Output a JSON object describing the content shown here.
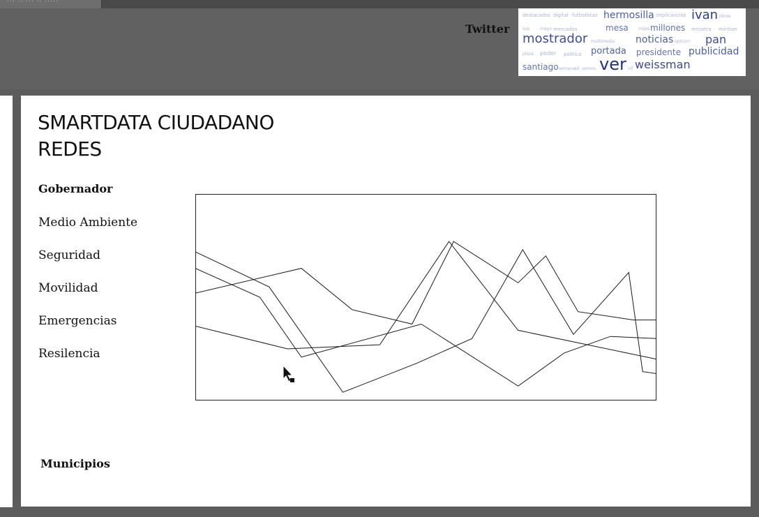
{
  "window": {
    "tab_text": "··· ·· ··· ·· ·····"
  },
  "header": {
    "twitter_label": "Twitter",
    "word_cloud": [
      {
        "text": "destacados",
        "size": 7,
        "color": "#aab3d6"
      },
      {
        "text": "digital",
        "size": 7,
        "color": "#aab3d6"
      },
      {
        "text": "futbolistas",
        "size": 7,
        "color": "#aab3d6"
      },
      {
        "text": "hermosilla",
        "size": 14,
        "color": "#4b5ea8"
      },
      {
        "text": "implicancias",
        "size": 7,
        "color": "#aab3d6"
      },
      {
        "text": "ivan",
        "size": 18,
        "color": "#2f3f8f"
      },
      {
        "text": "libros",
        "size": 6,
        "color": "#aab3d6"
      },
      {
        "text": "luis",
        "size": 6,
        "color": "#aab3d6"
      },
      {
        "text": "mayo",
        "size": 6,
        "color": "#aab3d6"
      },
      {
        "text": "mercados",
        "size": 7,
        "color": "#aab3d6"
      },
      {
        "text": "mesa",
        "size": 12,
        "color": "#6272b5"
      },
      {
        "text": "mijas",
        "size": 6,
        "color": "#aab3d6"
      },
      {
        "text": "millones",
        "size": 12,
        "color": "#6272b5"
      },
      {
        "text": "ministra",
        "size": 7,
        "color": "#aab3d6"
      },
      {
        "text": "mintion",
        "size": 7,
        "color": "#aab3d6"
      },
      {
        "text": "mostrador",
        "size": 18,
        "color": "#3b4c99"
      },
      {
        "text": "multimedia",
        "size": 6,
        "color": "#aab3d6"
      },
      {
        "text": "noticias",
        "size": 14,
        "color": "#4b5ea8"
      },
      {
        "text": "opinion",
        "size": 6,
        "color": "#aab3d6"
      },
      {
        "text": "pan",
        "size": 16,
        "color": "#3b4c99"
      },
      {
        "text": "plaza",
        "size": 6,
        "color": "#aab3d6"
      },
      {
        "text": "poder",
        "size": 8,
        "color": "#aab3d6"
      },
      {
        "text": "politica",
        "size": 7,
        "color": "#aab3d6"
      },
      {
        "text": "portada",
        "size": 13,
        "color": "#5062ad"
      },
      {
        "text": "presidente",
        "size": 12,
        "color": "#6272b5"
      },
      {
        "text": "publicidad",
        "size": 14,
        "color": "#4b5ea8"
      },
      {
        "text": "santiago",
        "size": 12,
        "color": "#6272b5"
      },
      {
        "text": "semana",
        "size": 6,
        "color": "#aab3d6"
      },
      {
        "text": "sil",
        "size": 6,
        "color": "#aab3d6"
      },
      {
        "text": "vemos",
        "size": 6,
        "color": "#aab3d6"
      },
      {
        "text": "ver",
        "size": 24,
        "color": "#23327e"
      },
      {
        "text": "vif",
        "size": 6,
        "color": "#aab3d6"
      },
      {
        "text": "weissman",
        "size": 16,
        "color": "#3b4c99"
      }
    ]
  },
  "panel": {
    "title_line1": "SMARTDATA CIUDADANO",
    "title_line2": "REDES",
    "menu": [
      {
        "label": "Gobernador",
        "bold": true
      },
      {
        "label": "Medio Ambiente",
        "bold": false
      },
      {
        "label": "Seguridad",
        "bold": false
      },
      {
        "label": "Movilidad",
        "bold": false
      },
      {
        "label": "Emergencias",
        "bold": false
      },
      {
        "label": "Resilencia",
        "bold": false
      }
    ],
    "municipios_label": "Municipios"
  },
  "chart_data": {
    "type": "line",
    "title": "",
    "xlabel": "",
    "ylabel": "",
    "grid": false,
    "xlim": [
      0,
      100
    ],
    "ylim": [
      0,
      100
    ],
    "line_color": "#1a1a1a",
    "series": [
      {
        "x": [
          0,
          23,
          34,
          47,
          56,
          70,
          76,
          83,
          95,
          100
        ],
        "y": [
          52,
          64,
          44,
          37,
          77,
          57,
          70,
          43,
          39,
          39
        ]
      },
      {
        "x": [
          0,
          14,
          23,
          49,
          70,
          80,
          90,
          100
        ],
        "y": [
          64,
          50,
          21,
          37,
          7,
          23,
          31,
          30
        ]
      },
      {
        "x": [
          0,
          20,
          40,
          55,
          70,
          100
        ],
        "y": [
          36,
          25,
          27,
          77,
          34,
          20
        ]
      },
      {
        "x": [
          0,
          16,
          32,
          48,
          60,
          71,
          82,
          94,
          97,
          100
        ],
        "y": [
          72,
          55,
          4,
          18,
          30,
          73,
          32,
          62,
          14,
          13
        ]
      }
    ]
  }
}
